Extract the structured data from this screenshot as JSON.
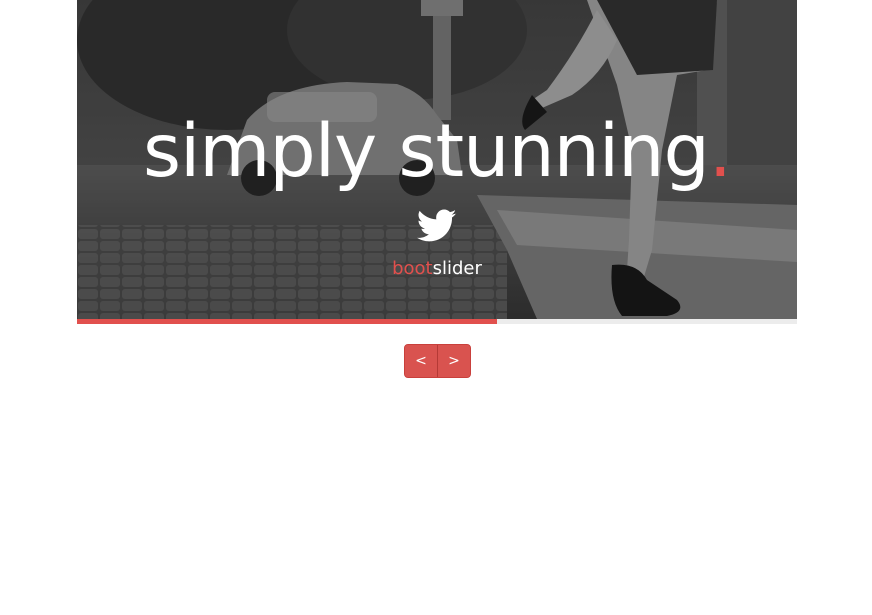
{
  "slider": {
    "headline": "simply stunning",
    "headline_dot": ".",
    "icon": "twitter-icon",
    "brand_part1": "boot",
    "brand_part2": "slider",
    "progress_fraction": 0.583
  },
  "nav": {
    "prev_label": "<",
    "next_label": ">"
  },
  "colors": {
    "accent": "#e1504d",
    "button": "#d9534f",
    "track": "#ececec"
  }
}
